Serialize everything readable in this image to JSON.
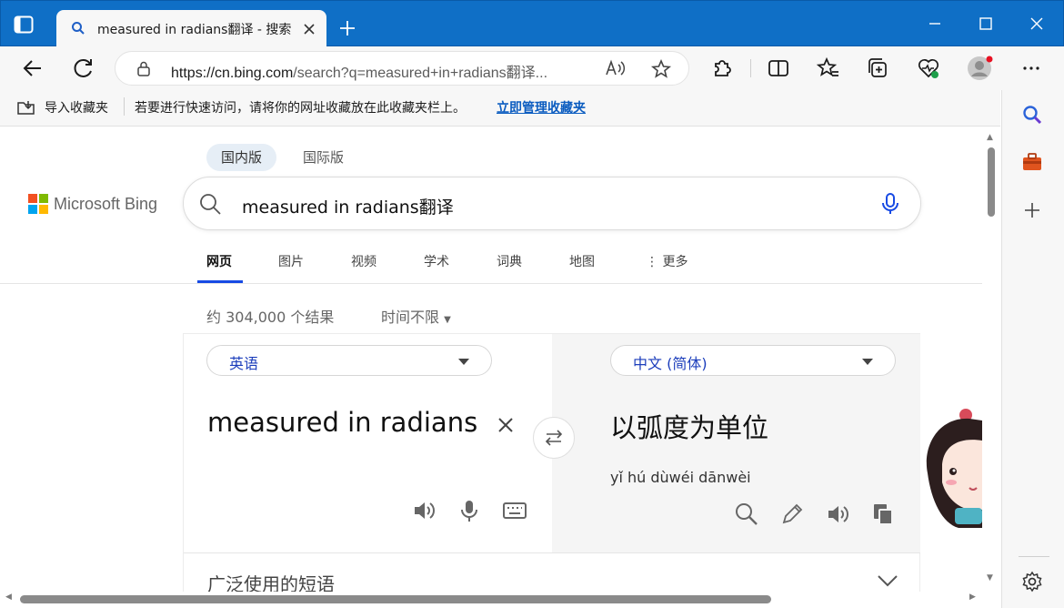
{
  "browser": {
    "tab_title": "measured in radians翻译 - 搜索",
    "url_domain": "https://cn.bing.com",
    "url_rest": "/search?q=measured+in+radians翻译...",
    "import_favorites": "导入收藏夹",
    "favorites_hint": "若要进行快速访问，请将你的网址收藏放在此收藏夹栏上。",
    "manage_favorites": "立即管理收藏夹"
  },
  "bing": {
    "logo_text": "Microsoft Bing",
    "region_domestic": "国内版",
    "region_international": "国际版",
    "query": "measured in radians翻译",
    "nav": [
      "网页",
      "图片",
      "视频",
      "学术",
      "词典",
      "地图",
      "更多"
    ],
    "result_count": "约 304,000 个结果",
    "time_filter": "时间不限"
  },
  "translator": {
    "source_language": "英语",
    "target_language": "中文 (简体)",
    "source_text": "measured in radians",
    "target_text": "以弧度为单位",
    "pinyin": "yǐ hú dùwéi dānwèi",
    "phrases_title": "广泛使用的短语"
  },
  "colors": {
    "titlebar": "#0f6fc6",
    "link_blue": "#0b5cc0",
    "bing_nav_active": "#174ae4",
    "lang_text": "#1b3dbb"
  }
}
